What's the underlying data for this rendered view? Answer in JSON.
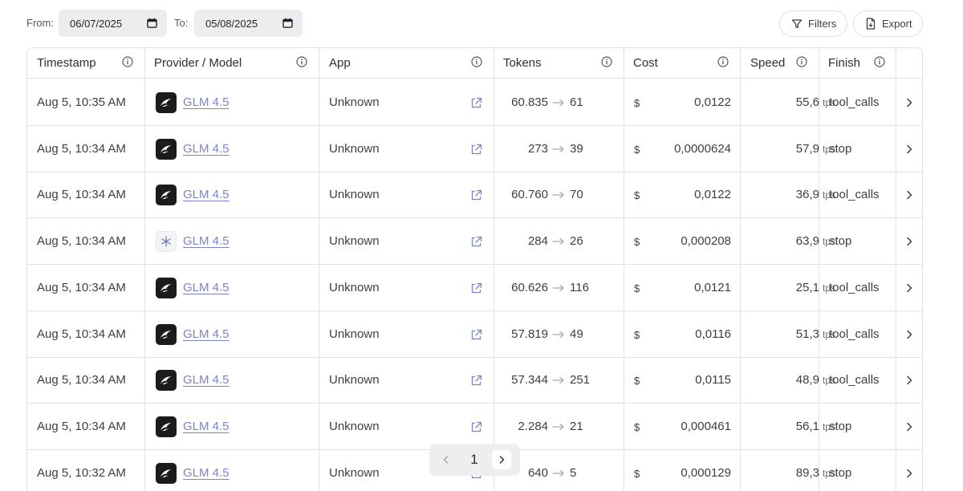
{
  "filters": {
    "from_label": "From:",
    "from_value": "06/07/2025",
    "to_label": "To:",
    "to_value": "05/08/2025",
    "filters_label": "Filters",
    "export_label": "Export"
  },
  "columns": [
    "Timestamp",
    "Provider / Model",
    "App",
    "Tokens",
    "Cost",
    "Speed",
    "Finish"
  ],
  "rows": [
    {
      "timestamp": "Aug 5, 10:35 AM",
      "provider_icon": "dark-wing-logo",
      "model": "GLM 4.5",
      "app": "Unknown",
      "tokens_in": "60.835",
      "tokens_out": "61",
      "currency": "$",
      "cost": "0,0122",
      "speed": "55,6",
      "speed_unit": "tps",
      "finish": "tool_calls"
    },
    {
      "timestamp": "Aug 5, 10:34 AM",
      "provider_icon": "dark-wing-logo",
      "model": "GLM 4.5",
      "app": "Unknown",
      "tokens_in": "273",
      "tokens_out": "39",
      "currency": "$",
      "cost": "0,0000624",
      "speed": "57,9",
      "speed_unit": "tps",
      "finish": "stop"
    },
    {
      "timestamp": "Aug 5, 10:34 AM",
      "provider_icon": "dark-wing-logo",
      "model": "GLM 4.5",
      "app": "Unknown",
      "tokens_in": "60.760",
      "tokens_out": "70",
      "currency": "$",
      "cost": "0,0122",
      "speed": "36,9",
      "speed_unit": "tps",
      "finish": "tool_calls"
    },
    {
      "timestamp": "Aug 5, 10:34 AM",
      "provider_icon": "light-snowflake-logo",
      "model": "GLM 4.5",
      "app": "Unknown",
      "tokens_in": "284",
      "tokens_out": "26",
      "currency": "$",
      "cost": "0,000208",
      "speed": "63,9",
      "speed_unit": "tps",
      "finish": "stop"
    },
    {
      "timestamp": "Aug 5, 10:34 AM",
      "provider_icon": "dark-wing-logo",
      "model": "GLM 4.5",
      "app": "Unknown",
      "tokens_in": "60.626",
      "tokens_out": "116",
      "currency": "$",
      "cost": "0,0121",
      "speed": "25,1",
      "speed_unit": "tps",
      "finish": "tool_calls"
    },
    {
      "timestamp": "Aug 5, 10:34 AM",
      "provider_icon": "dark-wing-logo",
      "model": "GLM 4.5",
      "app": "Unknown",
      "tokens_in": "57.819",
      "tokens_out": "49",
      "currency": "$",
      "cost": "0,0116",
      "speed": "51,3",
      "speed_unit": "tps",
      "finish": "tool_calls"
    },
    {
      "timestamp": "Aug 5, 10:34 AM",
      "provider_icon": "dark-wing-logo",
      "model": "GLM 4.5",
      "app": "Unknown",
      "tokens_in": "57.344",
      "tokens_out": "251",
      "currency": "$",
      "cost": "0,0115",
      "speed": "48,9",
      "speed_unit": "tps",
      "finish": "tool_calls"
    },
    {
      "timestamp": "Aug 5, 10:34 AM",
      "provider_icon": "dark-wing-logo",
      "model": "GLM 4.5",
      "app": "Unknown",
      "tokens_in": "2.284",
      "tokens_out": "21",
      "currency": "$",
      "cost": "0,000461",
      "speed": "56,1",
      "speed_unit": "tps",
      "finish": "stop"
    },
    {
      "timestamp": "Aug 5, 10:32 AM",
      "provider_icon": "dark-wing-logo",
      "model": "GLM 4.5",
      "app": "Unknown",
      "tokens_in": "640",
      "tokens_out": "5",
      "currency": "$",
      "cost": "0,000129",
      "speed": "89,3",
      "speed_unit": "tps",
      "finish": "stop"
    }
  ],
  "pagination": {
    "current_page": "1"
  },
  "colors": {
    "link": "#7c83c9",
    "border": "#dfe1e5",
    "pager_bg": "#eeeef0",
    "logo_dark": "#1b1b1b"
  }
}
